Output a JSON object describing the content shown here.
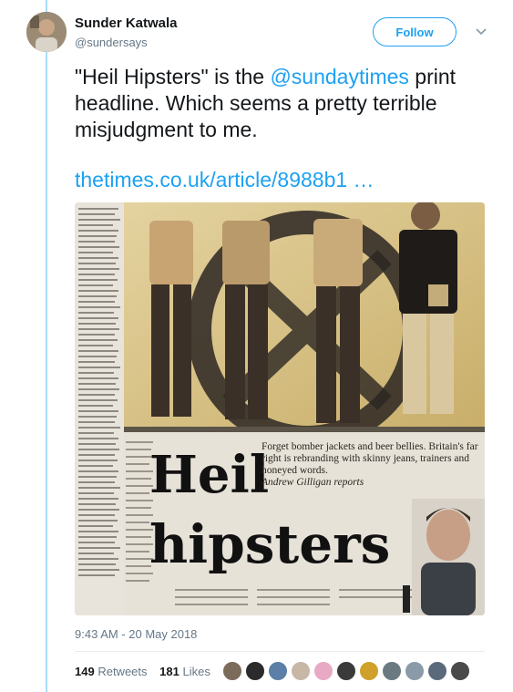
{
  "user": {
    "name": "Sunder Katwala",
    "handle": "@sundersays"
  },
  "follow_label": "Follow",
  "tweet": {
    "text_pre": "\"Heil Hipsters\" is the ",
    "mention": "@sundaytimes",
    "text_post": " print headline. Which seems a pretty terrible misjudgment to me.",
    "link": "thetimes.co.uk/article/8988b1 …"
  },
  "photo": {
    "headline_1": "Heil",
    "headline_2": "hipsters",
    "standfirst": "Forget bomber jackets and beer bellies. Britain's far right is rebranding with skinny jeans, trainers and honeyed words.",
    "byline": "Andrew Gilligan reports"
  },
  "timestamp": "9:43 AM - 20 May 2018",
  "stats": {
    "retweets_count": "149",
    "retweets_label": "Retweets",
    "likes_count": "181",
    "likes_label": "Likes"
  },
  "likers": [
    "#7a6b5a",
    "#2b2b2b",
    "#5b7fa6",
    "#c8b7a6",
    "#e8a9c4",
    "#3a3a3a",
    "#cfa12b",
    "#6b7a80",
    "#8a9aa8",
    "#5a6a7a",
    "#4a4a4a"
  ],
  "colors": {
    "accent": "#1da1f2",
    "text": "#14171a",
    "muted": "#657786",
    "rail": "#a8dcf7"
  }
}
